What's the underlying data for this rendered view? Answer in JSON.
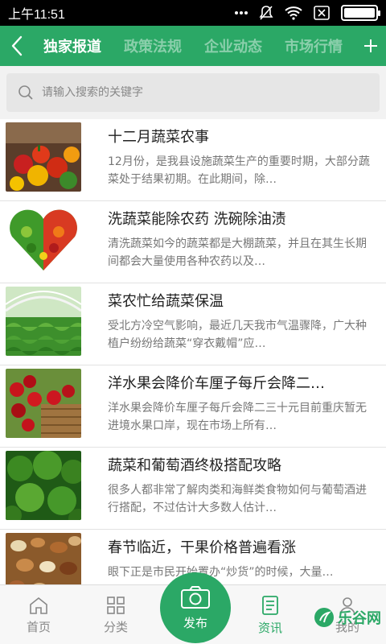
{
  "status_bar": {
    "time": "上午11:51"
  },
  "header": {
    "tabs": [
      {
        "label": "独家报道",
        "active": true
      },
      {
        "label": "政策法规",
        "active": false
      },
      {
        "label": "企业动态",
        "active": false
      },
      {
        "label": "市场行情",
        "active": false
      }
    ],
    "accent": "#2ba866"
  },
  "search": {
    "placeholder": "请输入搜索的关键字"
  },
  "news": [
    {
      "title": "十二月蔬菜农事",
      "desc": "12月份，是我县设施蔬菜生产的重要时期，大部分蔬菜处于结果初期。在此期间，除…",
      "thumb": "peppers"
    },
    {
      "title": "洗蔬菜能除农药 洗碗除油渍",
      "desc": "清洗蔬菜如今的蔬菜都是大棚蔬菜，并且在其生长期间都会大量使用各种农药以及…",
      "thumb": "veggie-heart"
    },
    {
      "title": "菜农忙给蔬菜保温",
      "desc": "受北方冷空气影响，最近几天我市气温骤降，广大种植户纷纷给蔬菜“穿衣戴帽”应…",
      "thumb": "greenhouse"
    },
    {
      "title": "洋水果会降价车厘子每斤会降二…",
      "desc": "洋水果会降价车厘子每斤会降二三十元目前重庆暂无进境水果口岸，现在市场上所有…",
      "thumb": "cherries"
    },
    {
      "title": "蔬菜和葡萄酒终极搭配攻略",
      "desc": "很多人都非常了解肉类和海鲜类食物如何与葡萄酒进行搭配，不过估计大多数人估计…",
      "thumb": "broccoli"
    },
    {
      "title": "春节临近，干果价格普遍看涨",
      "desc": "眼下正是市民开始置办“炒货”的时候，大量…",
      "thumb": "nuts"
    }
  ],
  "bottom_nav": {
    "home": "首页",
    "category": "分类",
    "publish": "发布",
    "news": "资讯",
    "mine": "我的"
  },
  "watermark": "乐谷网"
}
